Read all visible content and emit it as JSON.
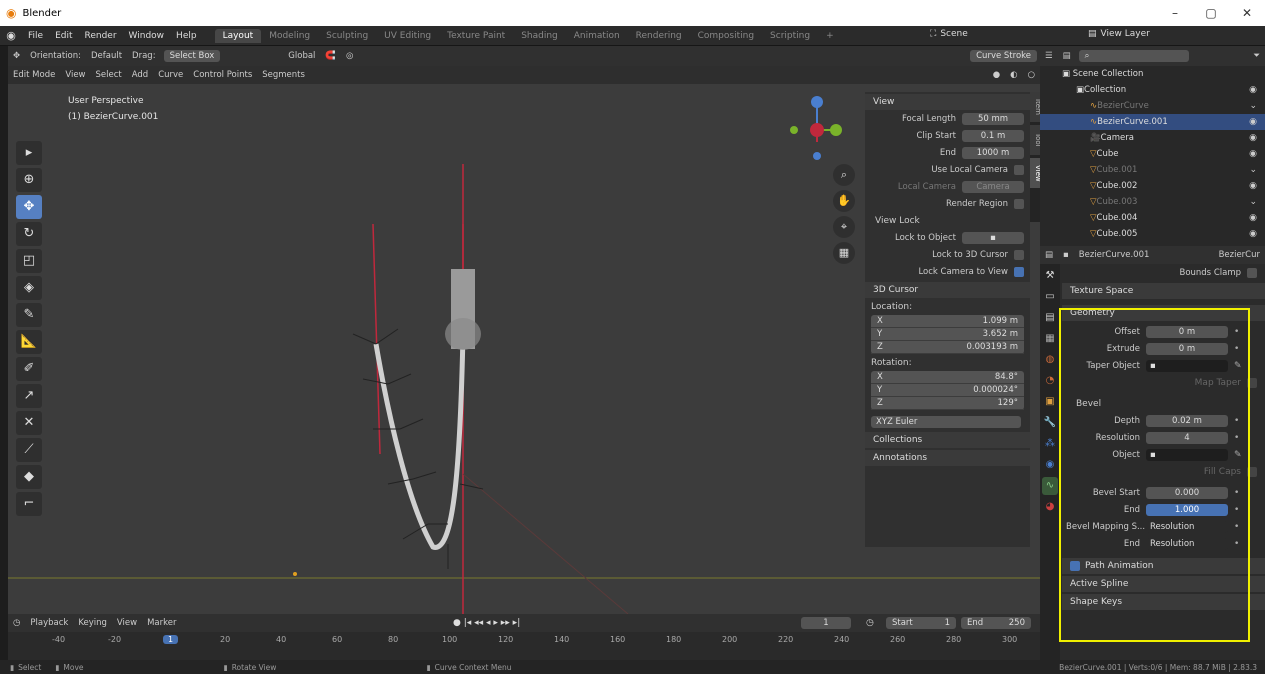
{
  "window": {
    "title": "Blender",
    "min": "–",
    "max": "▢",
    "close": "✕"
  },
  "menu": [
    "File",
    "Edit",
    "Render",
    "Window",
    "Help"
  ],
  "workspaces": [
    "Layout",
    "Modeling",
    "Sculpting",
    "UV Editing",
    "Texture Paint",
    "Shading",
    "Animation",
    "Rendering",
    "Compositing",
    "Scripting"
  ],
  "scene_label": "Scene",
  "view_layer_label": "View Layer",
  "viewport": {
    "orientation_label": "Orientation:",
    "orientation_value": "Default",
    "drag_label": "Drag:",
    "drag_value": "Select Box",
    "transform_label": "Global",
    "mode": "Edit Mode",
    "menus": [
      "View",
      "Select",
      "Add",
      "Curve",
      "Control Points",
      "Segments"
    ],
    "curve_stroke": "Curve Stroke",
    "perspective": "User Perspective",
    "object_name": "(1) BezierCurve.001"
  },
  "npanel": {
    "tabs": [
      "Item",
      "Tool",
      "View"
    ],
    "view_section": "View",
    "focal_length_label": "Focal Length",
    "focal_length": "50 mm",
    "clip_start_label": "Clip Start",
    "clip_start": "0.1 m",
    "end_label": "End",
    "clip_end": "1000 m",
    "use_local_camera": "Use Local Camera",
    "local_camera_label": "Local Camera",
    "local_camera_value": "Camera",
    "render_region": "Render Region",
    "view_lock": "View Lock",
    "lock_to_object": "Lock to Object",
    "lock_3d_cursor": "Lock to 3D Cursor",
    "lock_camera_view": "Lock Camera to View",
    "cursor_section": "3D Cursor",
    "location_label": "Location:",
    "loc": [
      {
        "axis": "X",
        "value": "1.099 m"
      },
      {
        "axis": "Y",
        "value": "3.652 m"
      },
      {
        "axis": "Z",
        "value": "0.003193 m"
      }
    ],
    "rotation_label": "Rotation:",
    "rot": [
      {
        "axis": "X",
        "value": "84.8°"
      },
      {
        "axis": "Y",
        "value": "0.000024°"
      },
      {
        "axis": "Z",
        "value": "129°"
      }
    ],
    "rotation_mode": "XYZ Euler",
    "collections": "Collections",
    "annotations": "Annotations"
  },
  "timeline": {
    "menus": [
      "Playback",
      "Keying",
      "View",
      "Marker"
    ],
    "current_frame": "1",
    "start_label": "Start",
    "start": "1",
    "end_label": "End",
    "end": "250",
    "ticks": [
      "-40",
      "-20",
      "1",
      "20",
      "40",
      "60",
      "80",
      "100",
      "120",
      "140",
      "160",
      "180",
      "200",
      "220",
      "240",
      "260",
      "280",
      "300"
    ]
  },
  "status": {
    "select": "Select",
    "move": "Move",
    "rotate_view": "Rotate View",
    "context_menu": "Curve Context Menu",
    "info": "BezierCurve.001 | Verts:0/6 | Mem: 88.7 MiB | 2.83.3"
  },
  "outliner": {
    "scene_collection": "Scene Collection",
    "items": [
      {
        "name": "Collection",
        "dim": false,
        "selected": false,
        "indent": 1
      },
      {
        "name": "BezierCurve",
        "dim": true,
        "selected": false,
        "indent": 2
      },
      {
        "name": "BezierCurve.001",
        "dim": false,
        "selected": true,
        "indent": 2
      },
      {
        "name": "Camera",
        "dim": false,
        "selected": false,
        "indent": 2
      },
      {
        "name": "Cube",
        "dim": false,
        "selected": false,
        "indent": 2
      },
      {
        "name": "Cube.001",
        "dim": true,
        "selected": false,
        "indent": 2
      },
      {
        "name": "Cube.002",
        "dim": false,
        "selected": false,
        "indent": 2
      },
      {
        "name": "Cube.003",
        "dim": true,
        "selected": false,
        "indent": 2
      },
      {
        "name": "Cube.004",
        "dim": false,
        "selected": false,
        "indent": 2
      },
      {
        "name": "Cube.005",
        "dim": false,
        "selected": false,
        "indent": 2
      }
    ]
  },
  "properties": {
    "object_name": "BezierCurve.001",
    "data_name": "BezierCur",
    "bounds_clamp": "Bounds Clamp",
    "texture_space": "Texture Space",
    "geometry": "Geometry",
    "offset_label": "Offset",
    "offset": "0 m",
    "extrude_label": "Extrude",
    "extrude": "0 m",
    "taper_label": "Taper Object",
    "map_taper": "Map Taper",
    "bevel": "Bevel",
    "depth_label": "Depth",
    "depth": "0.02 m",
    "resolution_label": "Resolution",
    "resolution": "4",
    "object_label": "Object",
    "fill_caps": "Fill Caps",
    "bevel_start_label": "Bevel Start",
    "bevel_start": "0.000",
    "bevel_end_label": "End",
    "bevel_end": "1.000",
    "mapping_start_label": "Bevel Mapping S...",
    "mapping_start": "Resolution",
    "mapping_end_label": "End",
    "mapping_end": "Resolution",
    "path_animation": "Path Animation",
    "active_spline": "Active Spline",
    "shape_keys": "Shape Keys"
  }
}
